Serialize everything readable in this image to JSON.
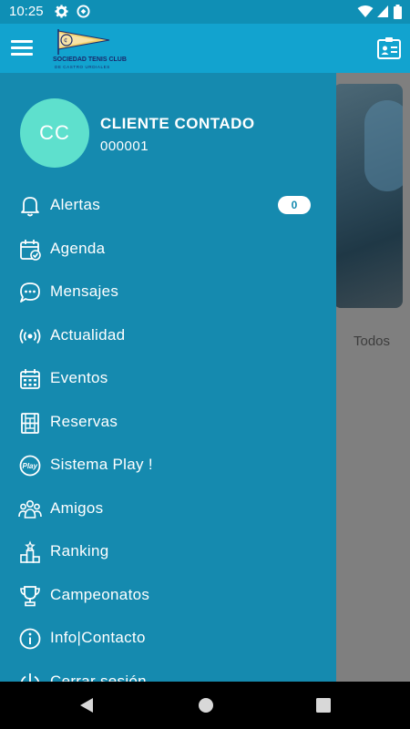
{
  "status_bar": {
    "time": "10:25"
  },
  "app_bar": {
    "logo_line1": "SOCIEDAD TENIS CLUB",
    "logo_line2": "DE CASTRO URDIALES",
    "menu_icon": "hamburger-icon",
    "profile_icon": "id-card-icon"
  },
  "background": {
    "filter_label": "Todos"
  },
  "drawer": {
    "user": {
      "initials": "CC",
      "name": "CLIENTE CONTADO",
      "id": "000001"
    },
    "items": [
      {
        "label": "Alertas",
        "icon": "bell-icon",
        "badge": "0"
      },
      {
        "label": "Agenda",
        "icon": "calendar-check-icon"
      },
      {
        "label": "Mensajes",
        "icon": "chat-bubble-icon"
      },
      {
        "label": "Actualidad",
        "icon": "broadcast-icon"
      },
      {
        "label": "Eventos",
        "icon": "calendar-grid-icon"
      },
      {
        "label": "Reservas",
        "icon": "court-icon"
      },
      {
        "label": "Sistema Play !",
        "icon": "play-badge-icon"
      },
      {
        "label": "Amigos",
        "icon": "friends-icon"
      },
      {
        "label": "Ranking",
        "icon": "podium-icon"
      },
      {
        "label": "Campeonatos",
        "icon": "trophy-icon"
      },
      {
        "label": "Info|Contacto",
        "icon": "info-icon"
      },
      {
        "label": "Cerrar sesión",
        "icon": "power-icon"
      }
    ]
  },
  "colors": {
    "drawer": "#158aaf",
    "header": "#12a3cf",
    "avatar": "#5ee0cd"
  }
}
